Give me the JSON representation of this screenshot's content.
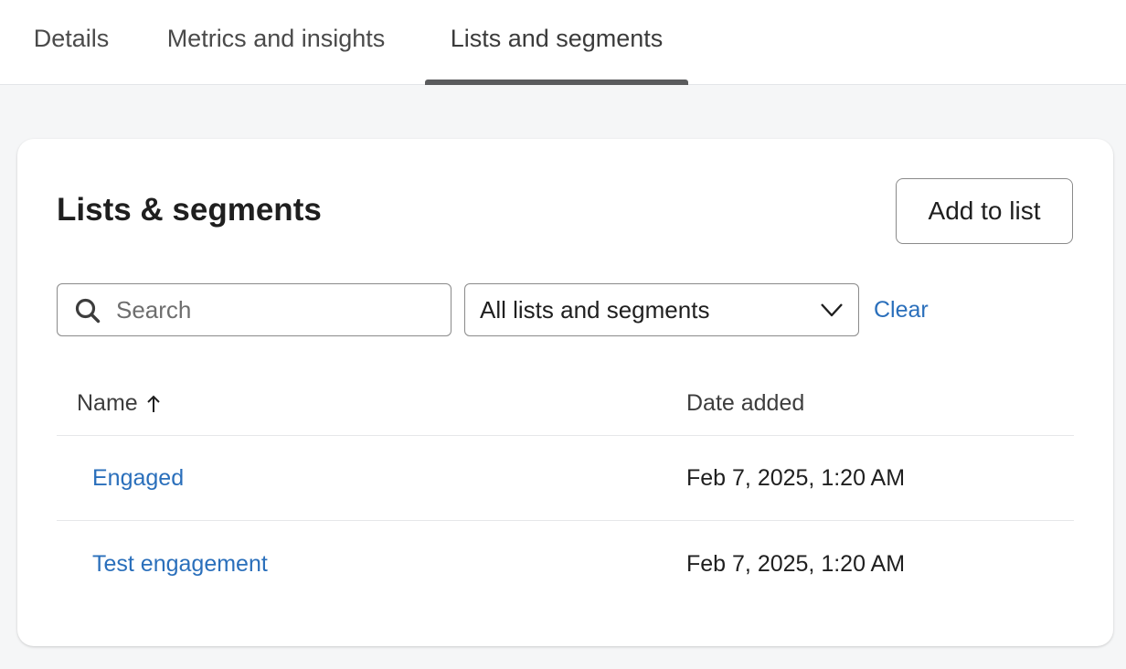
{
  "tabs": [
    {
      "label": "Details",
      "active": false
    },
    {
      "label": "Metrics and insights",
      "active": false
    },
    {
      "label": "Lists and segments",
      "active": true
    }
  ],
  "card": {
    "title": "Lists & segments",
    "add_button_label": "Add to list",
    "search": {
      "placeholder": "Search",
      "value": "",
      "icon": "search-icon"
    },
    "filter": {
      "selected": "All lists and segments",
      "icon": "chevron-down-icon"
    },
    "clear_label": "Clear",
    "table": {
      "columns": [
        {
          "label": "Name",
          "sort": "ascending",
          "sort_icon": "arrow-up-icon"
        },
        {
          "label": "Date added"
        }
      ],
      "rows": [
        {
          "name": "Engaged",
          "date_added": "Feb 7, 2025, 1:20 AM"
        },
        {
          "name": "Test engagement",
          "date_added": "Feb 7, 2025, 1:20 AM"
        }
      ]
    }
  },
  "colors": {
    "link": "#2a6fbb",
    "active_tab_indicator": "#5a5b5d",
    "page_background": "#f5f6f7"
  }
}
